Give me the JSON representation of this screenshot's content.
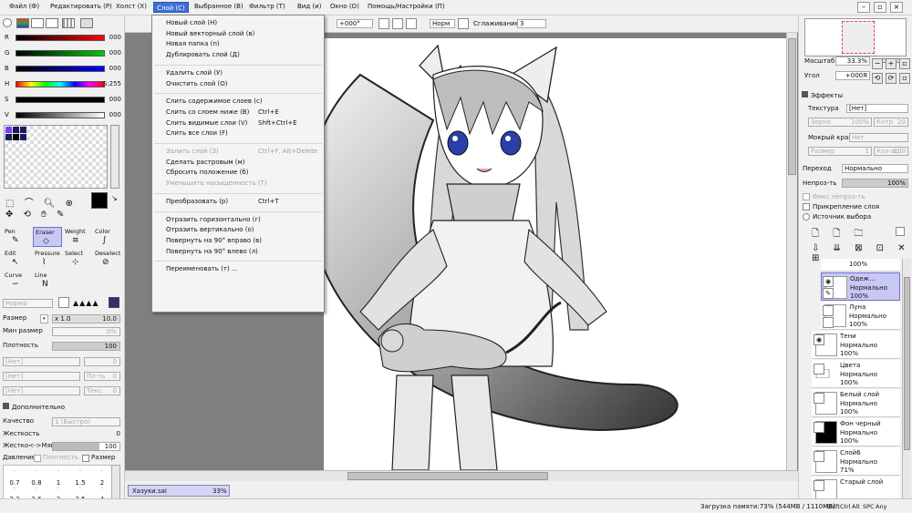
{
  "menubar": {
    "items": [
      "Файл (Ф)",
      "Редактировать (Р)",
      "Холст (Х)",
      "Слой (С)",
      "Выбранное (В)",
      "Фильтр (T)",
      "Вид (и)",
      "Окно (О)",
      "Помощь/Настройки (П)"
    ],
    "active_index": 3
  },
  "color_sliders": [
    {
      "label": "R",
      "value": "000"
    },
    {
      "label": "G",
      "value": "000"
    },
    {
      "label": "B",
      "value": "000"
    },
    {
      "label": "H",
      "value": "S:255"
    },
    {
      "label": "S",
      "value": "000"
    },
    {
      "label": "V",
      "value": "000"
    }
  ],
  "tools": [
    {
      "name": "Pen",
      "icon": "pen-icon",
      "glyph": "✎"
    },
    {
      "name": "Eraser",
      "icon": "eraser-icon",
      "glyph": "◇"
    },
    {
      "name": "Weight",
      "icon": "weight-icon",
      "glyph": "≡"
    },
    {
      "name": "Color",
      "icon": "color-icon",
      "glyph": "∫"
    },
    {
      "name": "Edit",
      "icon": "edit-icon",
      "glyph": "↖"
    },
    {
      "name": "Pressure",
      "icon": "pressure-icon",
      "glyph": "⌇"
    },
    {
      "name": "Select",
      "icon": "select-icon",
      "glyph": "⊹"
    },
    {
      "name": "Deselect",
      "icon": "deselect-icon",
      "glyph": "⊘"
    },
    {
      "name": "Curve",
      "icon": "curve-icon",
      "glyph": "∽"
    },
    {
      "name": "Line",
      "icon": "line-icon",
      "glyph": "N"
    }
  ],
  "brush": {
    "blend_mode": "Норма",
    "size_label": "Размер",
    "size_multiplier": "x 1.0",
    "size_value": "10.0",
    "min_size_label": "Мин размер",
    "min_size_value": "0%",
    "density_label": "Плотность",
    "density_value": "100",
    "tex1": "[Нет]",
    "tex1_val": "0",
    "tex2": "[Нет]",
    "tex2_label": "Пл-ть",
    "tex2_val": "0",
    "tex3": "[Нет]",
    "tex3_label": "Текс.",
    "tex3_val": "0"
  },
  "advanced": {
    "header": "Дополнительно",
    "quality_label": "Качество",
    "quality_value": "1 (Быстро)",
    "hardness_label": "Жесткость",
    "hardness_value": "0",
    "hard_soft_label": "Жестко<->Мягко",
    "hard_soft_value": "100",
    "pressure_label": "Давление:",
    "density_chk": "Плотность",
    "size_chk": "Размер"
  },
  "size_grid": {
    "row1": [
      "0.7",
      "0.8",
      "1",
      "1.5",
      "2"
    ],
    "row2": [
      "2.3",
      "2.6",
      "3",
      "3.5",
      "4"
    ]
  },
  "canvas_toolbar": {
    "angle": "+000°",
    "mode": "Норм",
    "smoothing_label": "Сглаживание",
    "smoothing_value": "3"
  },
  "layer_menu": {
    "items": [
      {
        "label": "Новый слой (Н)",
        "shortcut": "",
        "disabled": false
      },
      {
        "label": "Новый векторный слой (в)",
        "shortcut": "",
        "disabled": false
      },
      {
        "label": "Новая папка (п)",
        "shortcut": "",
        "disabled": false
      },
      {
        "label": "Дублировать слой (Д)",
        "shortcut": "",
        "disabled": false
      },
      {
        "sep": true
      },
      {
        "label": "Удалить слой (У)",
        "shortcut": "",
        "disabled": false
      },
      {
        "label": "Очистить слой (О)",
        "shortcut": "",
        "disabled": false
      },
      {
        "sep": true
      },
      {
        "label": "Слить содержимое слоев (с)",
        "shortcut": "",
        "disabled": false
      },
      {
        "label": "Слить со слоем ниже (В)",
        "shortcut": "Ctrl+E",
        "disabled": false
      },
      {
        "label": "Слить видимые слои (V)",
        "shortcut": "Shft+Ctrl+E",
        "disabled": false
      },
      {
        "label": "Слить все слои (F)",
        "shortcut": "",
        "disabled": false
      },
      {
        "sep": true
      },
      {
        "label": "Залить слой (З)",
        "shortcut": "Ctrl+F, Alt+Delete",
        "disabled": true
      },
      {
        "label": "Сделать растровым (м)",
        "shortcut": "",
        "disabled": false
      },
      {
        "label": "Сбросить положение (б)",
        "shortcut": "",
        "disabled": false
      },
      {
        "label": "Уменьшить насыщенность (Т)",
        "shortcut": "",
        "disabled": true
      },
      {
        "sep": true
      },
      {
        "label": "Преобразовать (р)",
        "shortcut": "Ctrl+T",
        "disabled": false
      },
      {
        "sep": true
      },
      {
        "label": "Отразить горизонтально (г)",
        "shortcut": "",
        "disabled": false
      },
      {
        "label": "Отразить вертикально (о)",
        "shortcut": "",
        "disabled": false
      },
      {
        "label": "Повернуть на 90° вправо (в)",
        "shortcut": "",
        "disabled": false
      },
      {
        "label": "Повернуть на 90° влево (л)",
        "shortcut": "",
        "disabled": false
      },
      {
        "sep": true
      },
      {
        "label": "Переименовать (т) ...",
        "shortcut": "",
        "disabled": false
      }
    ]
  },
  "navigator": {
    "zoom_label": "Масштаб",
    "zoom_value": "33.3%",
    "angle_label": "Угол",
    "angle_value": "+000Я"
  },
  "effects": {
    "header": "Эффекты",
    "texture_label": "Текстура",
    "texture_value": "[Нет]",
    "grain_label": "Зерно",
    "grain_value": "100%",
    "contrast_label": "Кнтр",
    "contrast_value": "20",
    "wet_edge_label": "Мокрый край",
    "wet_edge_value": "Нет",
    "size_label": "Размер",
    "size_value": "1",
    "strength_label": "Кол-во",
    "strength_value": "100"
  },
  "layer_props": {
    "blend_label": "Переход",
    "blend_value": "Нормально",
    "opacity_label": "Непроз-ть",
    "opacity_value": "100%",
    "fix_opacity": "Фикс непроз-ть",
    "clip": "Прикрепление слоя",
    "selection_source": "Источник выбора"
  },
  "layers": [
    {
      "name": "",
      "mode": "",
      "opacity": "100%",
      "selected": false,
      "eye": false,
      "partial": true
    },
    {
      "name": "Одеж...",
      "mode": "Нормально",
      "opacity": "100%",
      "selected": true,
      "eye": true
    },
    {
      "name": "Луна",
      "mode": "Нормально",
      "opacity": "100%",
      "selected": false,
      "eye": false
    },
    {
      "name": "Тени",
      "mode": "Нормально",
      "opacity": "100%",
      "selected": false,
      "eye": true
    },
    {
      "name": "Цвета",
      "mode": "Нормально",
      "opacity": "100%",
      "selected": false,
      "eye": false,
      "folder": true
    },
    {
      "name": "Белый слой",
      "mode": "Нормально",
      "opacity": "100%",
      "selected": false,
      "eye": false
    },
    {
      "name": "Фон черный",
      "mode": "Нормально",
      "opacity": "100%",
      "selected": false,
      "eye": false,
      "black": true
    },
    {
      "name": "Слой6",
      "mode": "Нормально",
      "opacity": "71%",
      "selected": false,
      "eye": false
    },
    {
      "name": "Старый слой",
      "mode": "",
      "opacity": "",
      "selected": false,
      "eye": false
    }
  ],
  "document_tab": {
    "name": "Хазуки.sai",
    "zoom": "33%"
  },
  "status": {
    "memory": "Загрузка памяти:73% (544MB / 1110MB)",
    "keys": [
      "Shift",
      "Ctrl",
      "Alt",
      "SPC",
      "Any"
    ]
  }
}
